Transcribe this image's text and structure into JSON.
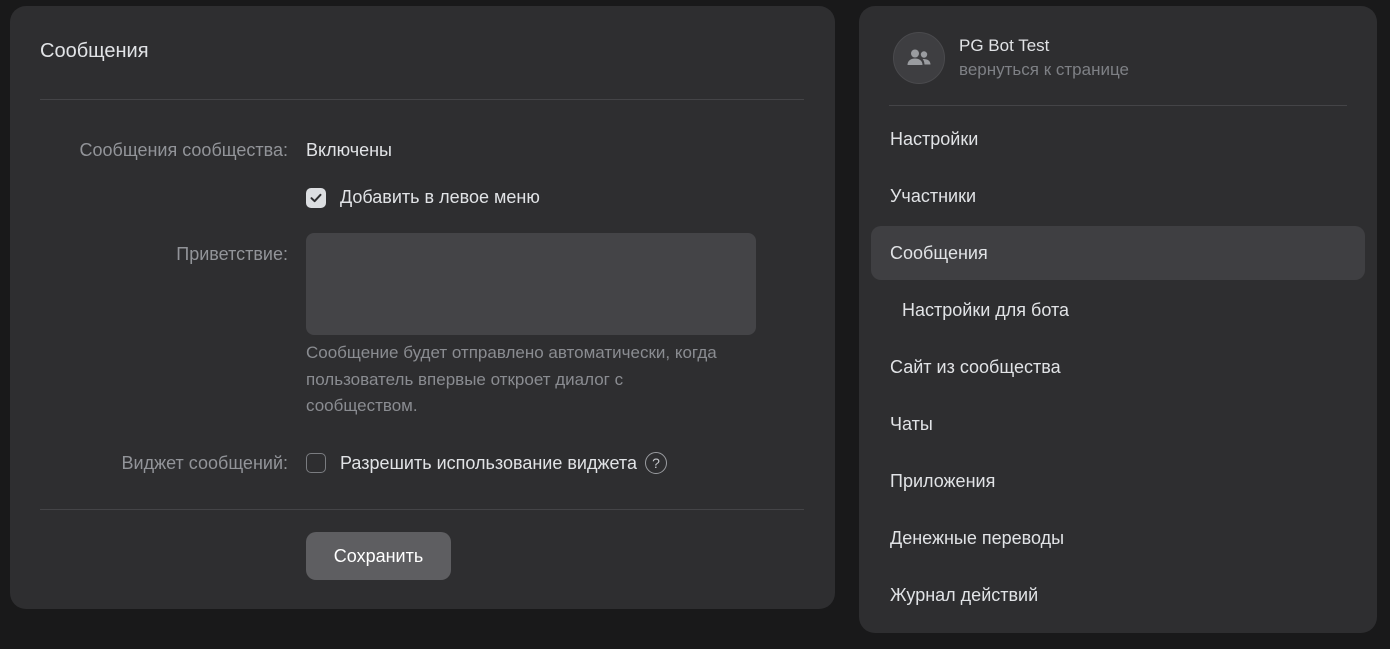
{
  "main": {
    "title": "Сообщения",
    "community_messages_label": "Сообщения сообщества:",
    "community_messages_value": "Включены",
    "left_menu_checkbox_label": "Добавить в левое меню",
    "left_menu_checked": true,
    "greeting_label": "Приветствие:",
    "greeting_value": "",
    "greeting_hint": "Сообщение будет отправлено автоматически, когда пользователь впервые откроет диалог с сообществом.",
    "widget_label": "Виджет сообщений:",
    "widget_checkbox_label": "Разрешить использование виджета",
    "widget_checked": false,
    "help_icon": "question-icon",
    "help_glyph": "?",
    "save_label": "Сохранить"
  },
  "sidebar": {
    "group_name": "PG Bot Test",
    "back_link": "вернуться к странице",
    "avatar_icon": "users-icon",
    "items": [
      {
        "label": "Настройки",
        "active": false,
        "sub": false
      },
      {
        "label": "Участники",
        "active": false,
        "sub": false
      },
      {
        "label": "Сообщения",
        "active": true,
        "sub": false
      },
      {
        "label": "Настройки для бота",
        "active": false,
        "sub": true
      },
      {
        "label": "Сайт из сообщества",
        "active": false,
        "sub": false
      },
      {
        "label": "Чаты",
        "active": false,
        "sub": false
      },
      {
        "label": "Приложения",
        "active": false,
        "sub": false
      },
      {
        "label": "Денежные переводы",
        "active": false,
        "sub": false
      },
      {
        "label": "Журнал действий",
        "active": false,
        "sub": false
      }
    ]
  },
  "colors": {
    "background": "#19191a",
    "card": "#2e2e30",
    "active_item": "#3f3f42",
    "button": "#5e5e61",
    "text_primary": "#e1e3e6",
    "text_secondary": "#929499"
  }
}
